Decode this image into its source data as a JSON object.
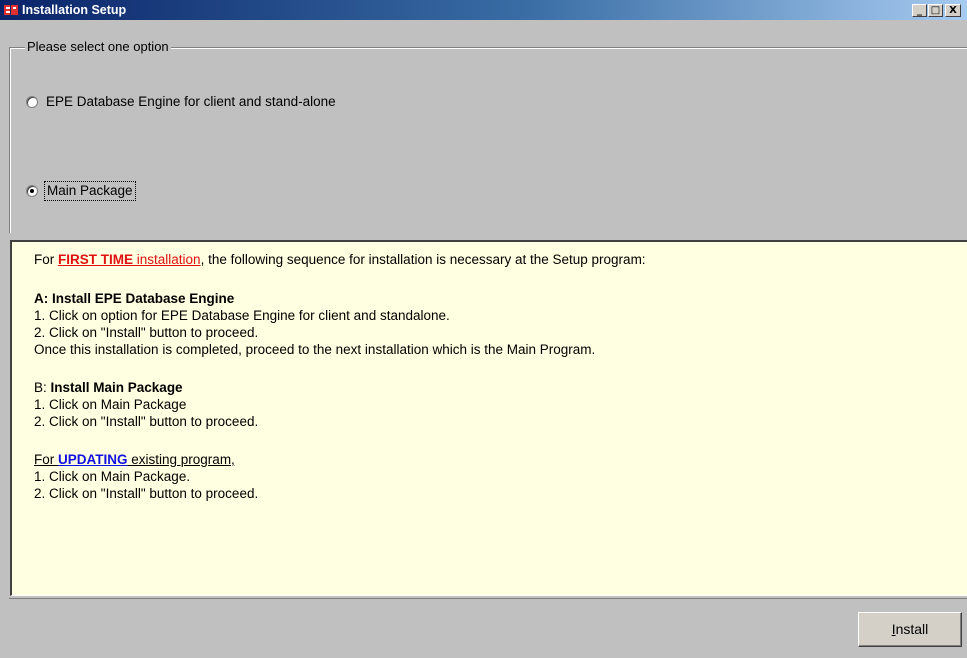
{
  "window": {
    "title": "Installation Setup",
    "min_glyph": "_",
    "max_glyph": "□",
    "close_glyph": "X",
    "icon": "setup-app-icon"
  },
  "group": {
    "legend": "Please select one option",
    "options": [
      {
        "label": "EPE Database Engine for client and stand-alone",
        "selected": false
      },
      {
        "label": "Main Package",
        "selected": true
      }
    ]
  },
  "info": {
    "intro_pre": "For ",
    "intro_first_time": "FIRST TIME",
    "intro_installation": " installation",
    "intro_post": ", the following sequence for installation is necessary at the Setup program:",
    "section_a_title": "A:  Install EPE Database Engine",
    "a1": "1.   Click on option for EPE Database Engine for client and standalone.",
    "a2": "2.   Click on \"Install\" button to proceed.",
    "a_note": "Once this installation is completed, proceed to the next installation which is the Main Program.",
    "section_b_prefix": "B: ",
    "section_b_title": "Install Main Package",
    "b1": "1.   Click on Main Package",
    "b2": "2.   Click on \"Install\" button to proceed.",
    "update_pre": "For ",
    "update_word": "UPDATING",
    "update_post": " existing program,",
    "u1": "1.   Click on Main Package.",
    "u2": "2.   Click on \"Install\" button to proceed."
  },
  "footer": {
    "install_mnemonic": "I",
    "install_rest": "nstall"
  },
  "colors": {
    "title_bar": "#0a246a",
    "info_bg": "#ffffe1",
    "emphasis_red": "#e01010",
    "emphasis_blue": "#1010e0",
    "dialog_bg": "#c0c0c0"
  }
}
